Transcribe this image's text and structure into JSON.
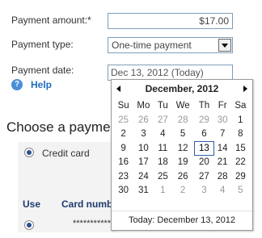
{
  "form": {
    "amount_label": "Payment amount:*",
    "amount_value": "$17.00",
    "type_label": "Payment type:",
    "type_value": "One-time payment",
    "date_label": "Payment date:",
    "date_value": "Dec 13, 2012 (Today)",
    "help_label": "Help"
  },
  "section": {
    "heading": "Choose a payment method",
    "credit_card_label": "Credit card",
    "col_use": "Use",
    "col_card": "Card number",
    "card_masked": "************"
  },
  "calendar": {
    "month_label": "December, 2012",
    "weekdays": [
      "Su",
      "Mo",
      "Tu",
      "We",
      "Th",
      "Fr",
      "Sa"
    ],
    "weeks": [
      [
        {
          "d": "25",
          "o": true
        },
        {
          "d": "26",
          "o": true
        },
        {
          "d": "27",
          "o": true
        },
        {
          "d": "28",
          "o": true
        },
        {
          "d": "29",
          "o": true
        },
        {
          "d": "30",
          "o": true
        },
        {
          "d": "1"
        }
      ],
      [
        {
          "d": "2"
        },
        {
          "d": "3"
        },
        {
          "d": "4"
        },
        {
          "d": "5"
        },
        {
          "d": "6"
        },
        {
          "d": "7"
        },
        {
          "d": "8"
        }
      ],
      [
        {
          "d": "9"
        },
        {
          "d": "10"
        },
        {
          "d": "11"
        },
        {
          "d": "12"
        },
        {
          "d": "13",
          "t": true
        },
        {
          "d": "14"
        },
        {
          "d": "15"
        }
      ],
      [
        {
          "d": "16"
        },
        {
          "d": "17"
        },
        {
          "d": "18"
        },
        {
          "d": "19"
        },
        {
          "d": "20"
        },
        {
          "d": "21"
        },
        {
          "d": "22"
        }
      ],
      [
        {
          "d": "23"
        },
        {
          "d": "24"
        },
        {
          "d": "25"
        },
        {
          "d": "26"
        },
        {
          "d": "27"
        },
        {
          "d": "28"
        },
        {
          "d": "29"
        }
      ],
      [
        {
          "d": "30"
        },
        {
          "d": "31"
        },
        {
          "d": "1",
          "o": true
        },
        {
          "d": "2",
          "o": true
        },
        {
          "d": "3",
          "o": true
        },
        {
          "d": "4",
          "o": true
        },
        {
          "d": "5",
          "o": true
        }
      ]
    ],
    "today_label": "Today: December 13, 2012",
    "selected_day": "13"
  },
  "icons": {
    "help": "help-icon",
    "prev": "chevron-left-icon",
    "next": "chevron-right-icon",
    "dropdown": "chevron-down-icon"
  },
  "colors": {
    "link": "#1f6cbf",
    "field_border": "#7f9db9",
    "today_border": "#2f5ea8",
    "table_header": "#1d3c6e"
  }
}
